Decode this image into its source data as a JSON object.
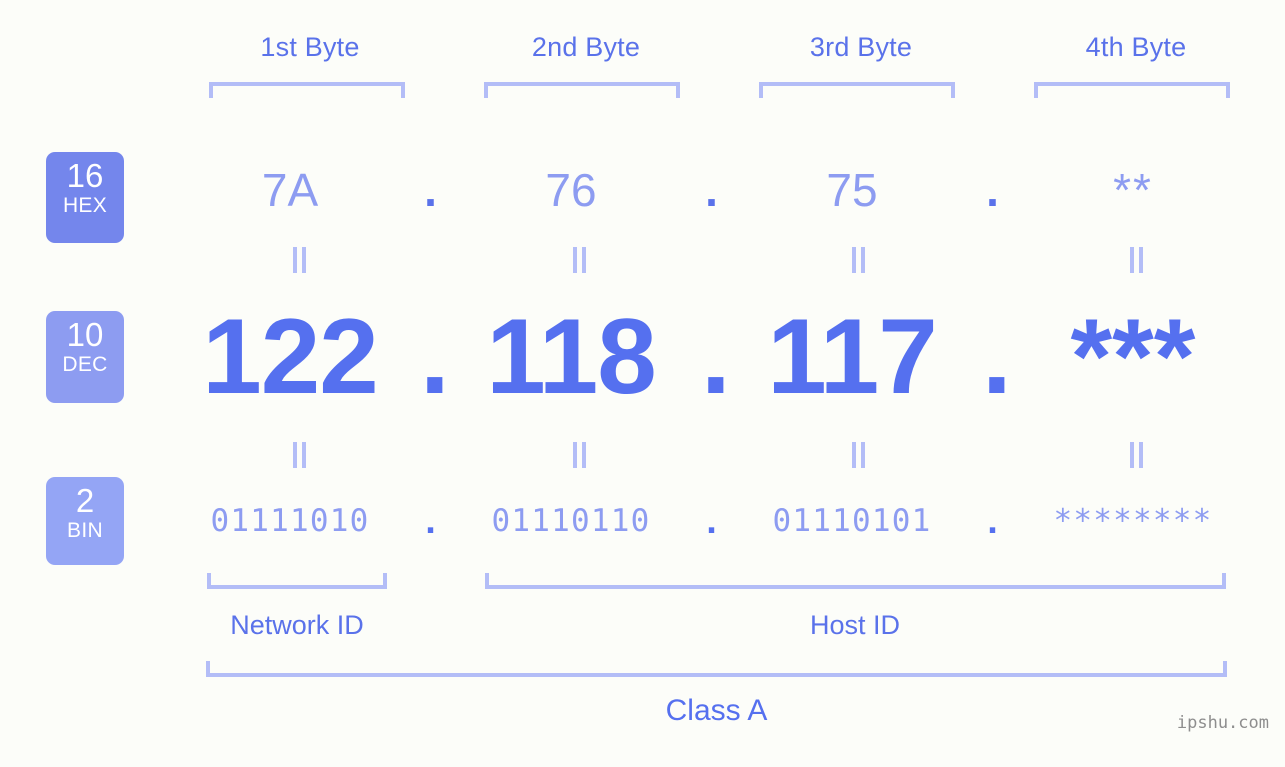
{
  "byte_headers": [
    {
      "label": "1st Byte"
    },
    {
      "label": "2nd Byte"
    },
    {
      "label": "3rd Byte"
    },
    {
      "label": "4th Byte"
    }
  ],
  "bases": {
    "hex": {
      "number": "16",
      "abbr": "HEX",
      "badge_color": "#7486ec"
    },
    "dec": {
      "number": "10",
      "abbr": "DEC",
      "badge_color": "#8d9cf1"
    },
    "bin": {
      "number": "2",
      "abbr": "BIN",
      "badge_color": "#94a5f5"
    }
  },
  "rows": {
    "hex": {
      "values": [
        "7A",
        "76",
        "75",
        "**"
      ],
      "separator": "."
    },
    "dec": {
      "values": [
        "122",
        "118",
        "117",
        "***"
      ],
      "separator": "."
    },
    "bin": {
      "values": [
        "01111010",
        "01110110",
        "01110101",
        "********"
      ],
      "separator": "."
    }
  },
  "equality_symbol": "=",
  "sections": {
    "network_id": "Network ID",
    "host_id": "Host ID"
  },
  "class": {
    "label": "Class A"
  },
  "watermark": "ipshu.com",
  "colors": {
    "background": "#fcfdf9",
    "bracket": "#b3bdf7",
    "header_text": "#5a72ea",
    "hex_value": "#8d9cf1",
    "dec_value": "#5570ef",
    "bin_value": "#8d9cf1",
    "watermark": "#8e8e8e"
  }
}
